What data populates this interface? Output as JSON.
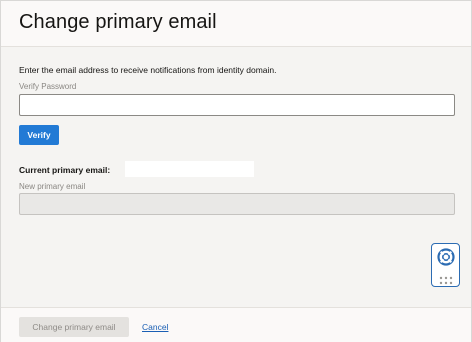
{
  "dialog": {
    "title": "Change primary email"
  },
  "form": {
    "intro": "Enter the email address to receive notifications from identity domain.",
    "verify_password_label": "Verify Password",
    "verify_password_value": "",
    "verify_button_label": "Verify",
    "current_email_label": "Current primary email:",
    "current_email_value": "",
    "new_email_label": "New primary email",
    "new_email_value": ""
  },
  "footer": {
    "change_button_label": "Change primary email",
    "cancel_label": "Cancel"
  },
  "help_widget": {
    "icon": "lifebuoy-icon",
    "handle_icon": "drag-handle-icon"
  },
  "colors": {
    "primary_button": "#227ad5",
    "link": "#1a5fb4",
    "disabled_button": "#e4e2df",
    "widget_border": "#2c6cb3"
  }
}
